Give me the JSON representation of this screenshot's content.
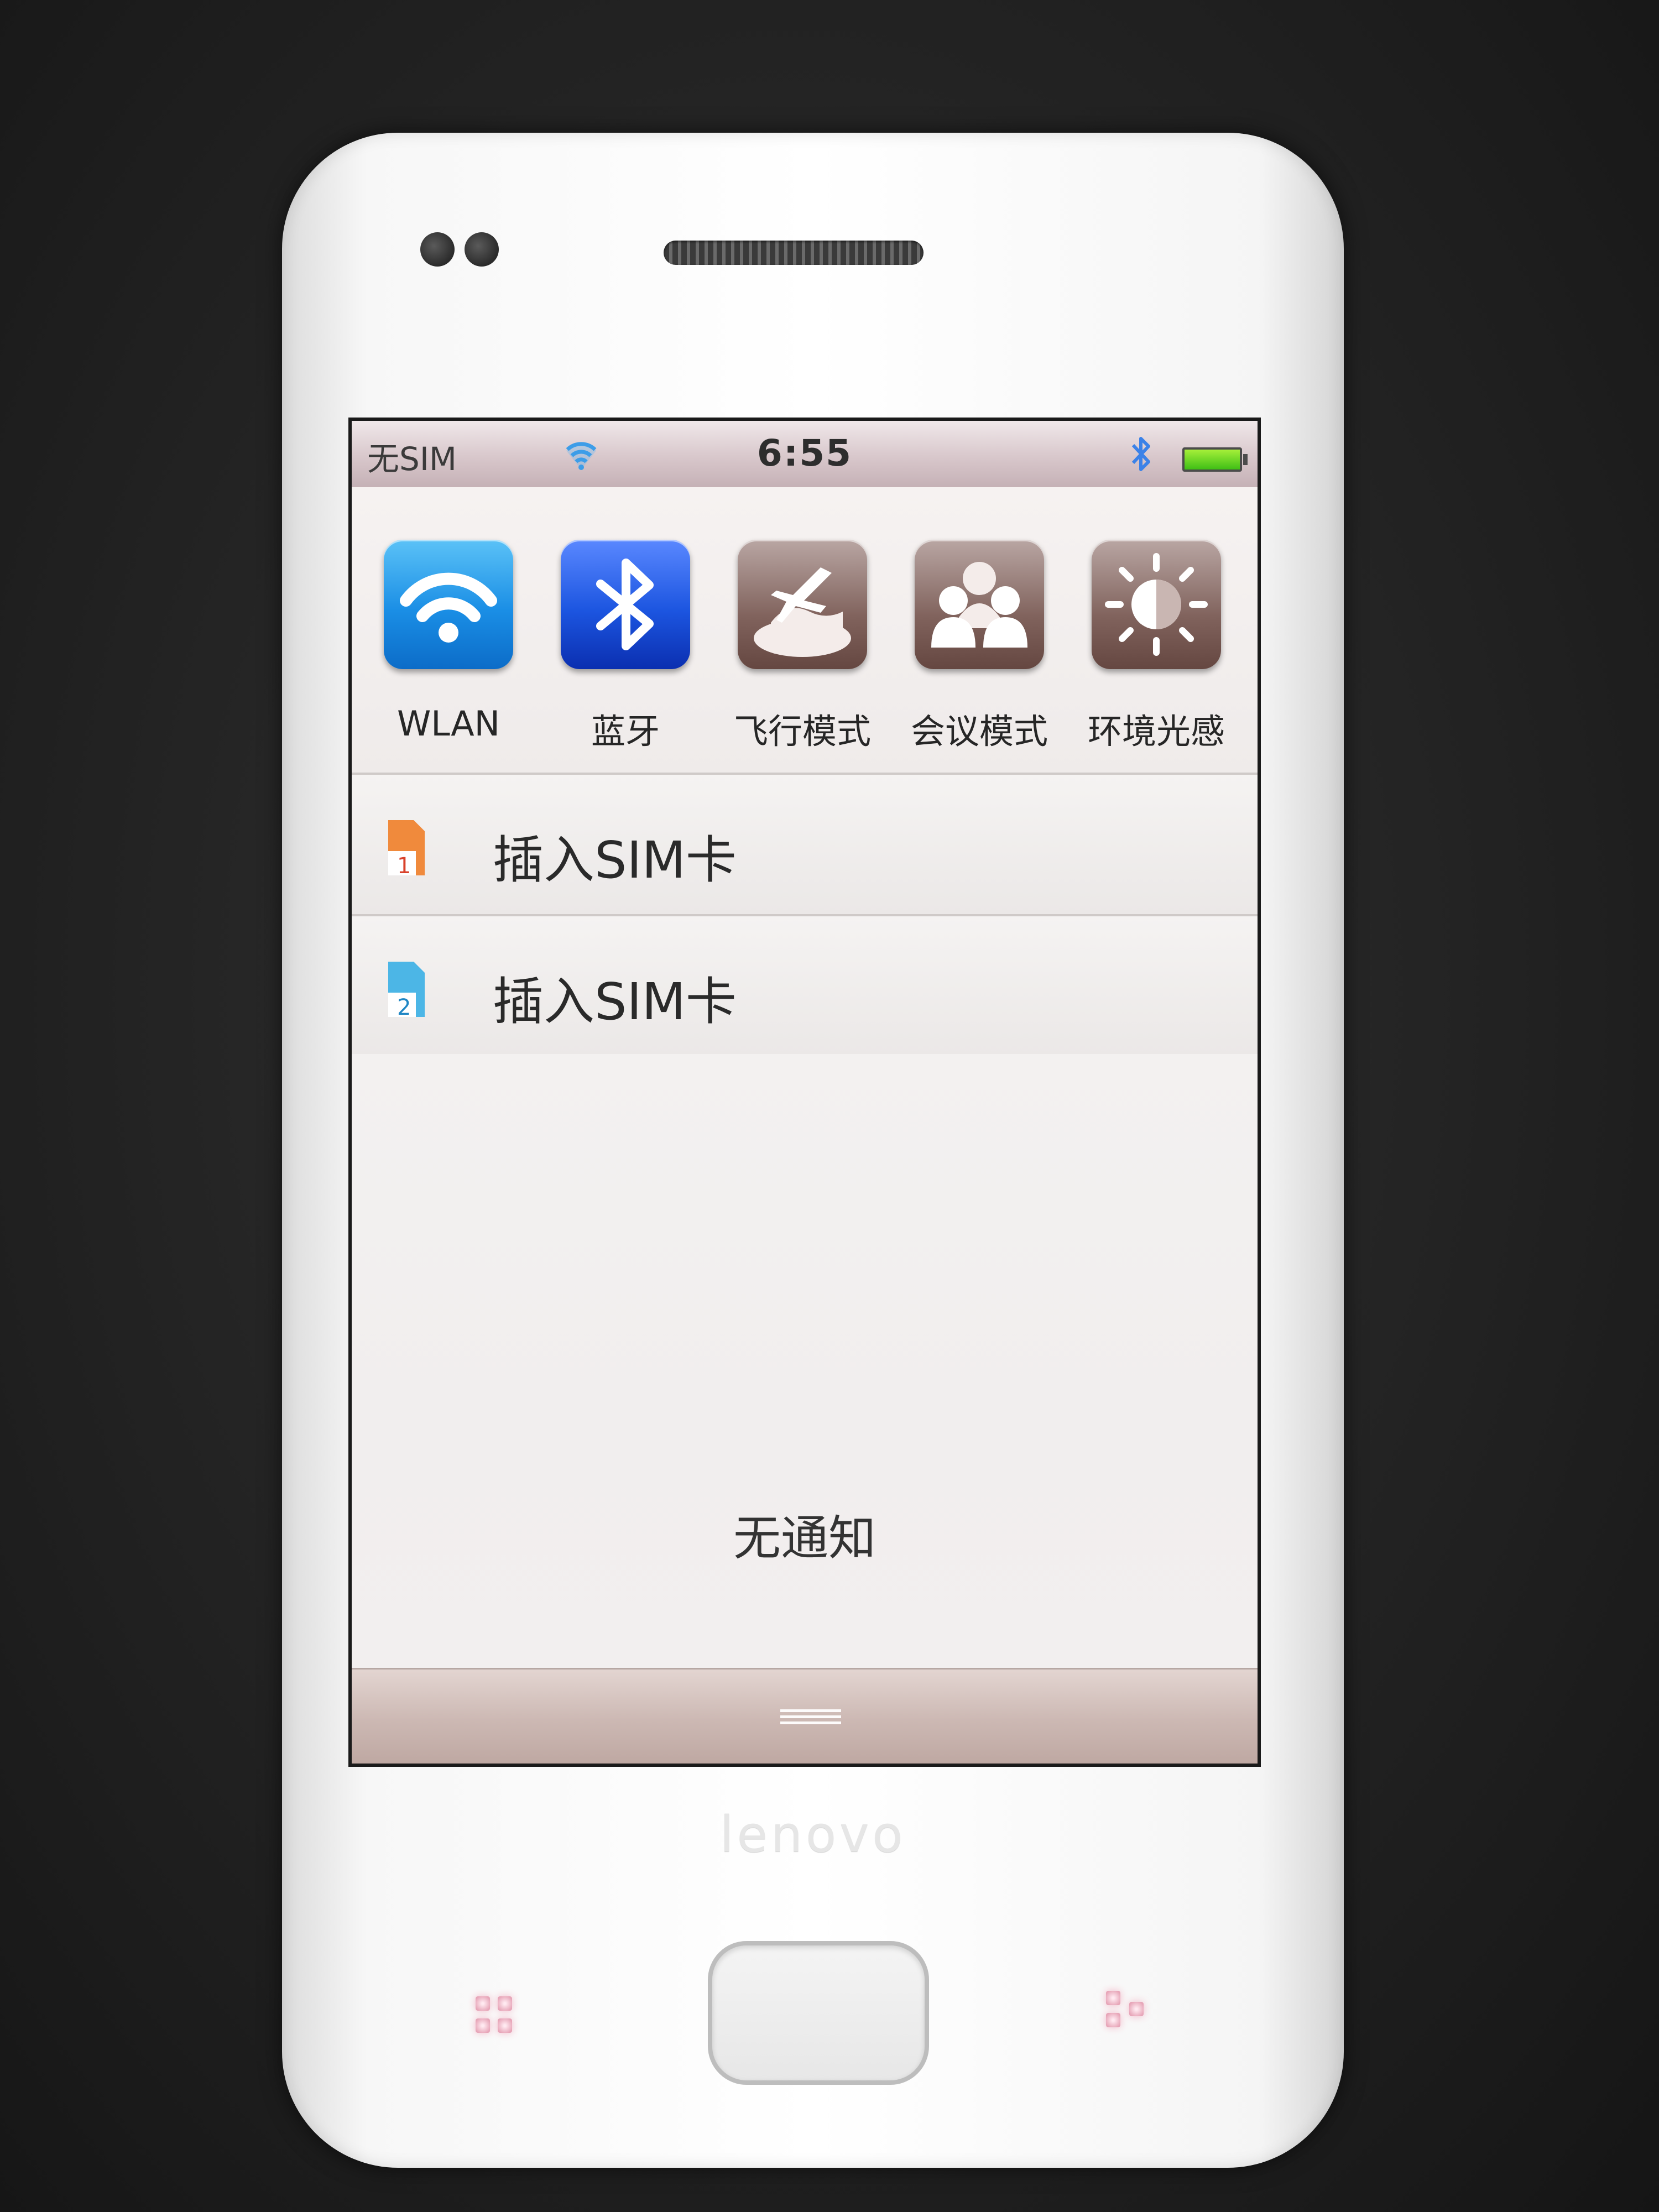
{
  "status_bar": {
    "carrier": "无SIM",
    "time": "6:55",
    "icons": [
      "wifi-icon",
      "bluetooth-icon",
      "battery-icon"
    ],
    "battery_color": "#3fbf15"
  },
  "quick_toggles": [
    {
      "label": "WLAN",
      "icon": "wifi-icon",
      "state": "on",
      "color": "#1a8ee5"
    },
    {
      "label": "蓝牙",
      "icon": "bluetooth-icon",
      "state": "on",
      "color": "#1c55e0"
    },
    {
      "label": "飞行模式",
      "icon": "airplane-icon",
      "state": "off",
      "color": "#80625c"
    },
    {
      "label": "会议模式",
      "icon": "meeting-icon",
      "state": "off",
      "color": "#80625c"
    },
    {
      "label": "环境光感",
      "icon": "brightness-icon",
      "state": "off",
      "color": "#80625c"
    }
  ],
  "sim_slots": [
    {
      "label": "插入SIM卡",
      "icon": "sim1-icon",
      "color": "#e8532a"
    },
    {
      "label": "插入SIM卡",
      "icon": "sim2-icon",
      "color": "#2aa0d6"
    }
  ],
  "notifications": {
    "empty_text": "无通知"
  },
  "hardware_keys": [
    "menu-key-icon",
    "home-button",
    "back-key-icon"
  ]
}
